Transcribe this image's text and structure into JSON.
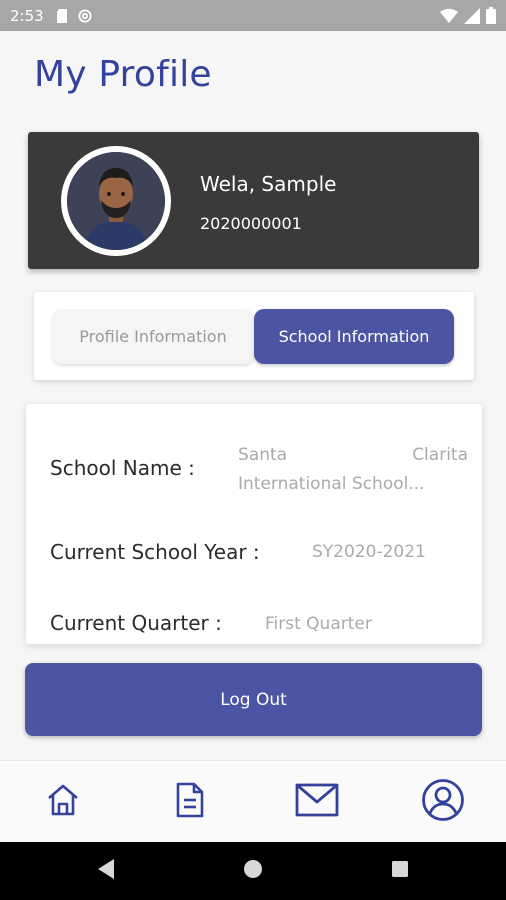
{
  "status_bar": {
    "time": "2:53"
  },
  "page": {
    "title": "My Profile"
  },
  "profile": {
    "name": "Wela, Sample",
    "id": "2020000001"
  },
  "tabs": [
    {
      "label": "Profile Information",
      "active": false
    },
    {
      "label": "School Information",
      "active": true
    }
  ],
  "school_info": {
    "school_name_label": "School Name :",
    "school_name_value_line1_a": "Santa",
    "school_name_value_line1_b": "Clarita",
    "school_name_value_line2": "International School...",
    "school_year_label": "Current School Year :",
    "school_year_value": "SY2020-2021",
    "quarter_label": "Current Quarter :",
    "quarter_value": "First Quarter"
  },
  "actions": {
    "logout_label": "Log Out"
  },
  "colors": {
    "primary": "#4b55a3",
    "title": "#33439c",
    "card_dark": "#3a3a3a",
    "status_bar": "#a7a7a7"
  },
  "bottom_nav": [
    {
      "icon": "home-icon"
    },
    {
      "icon": "document-icon"
    },
    {
      "icon": "mail-icon"
    },
    {
      "icon": "profile-icon"
    }
  ]
}
